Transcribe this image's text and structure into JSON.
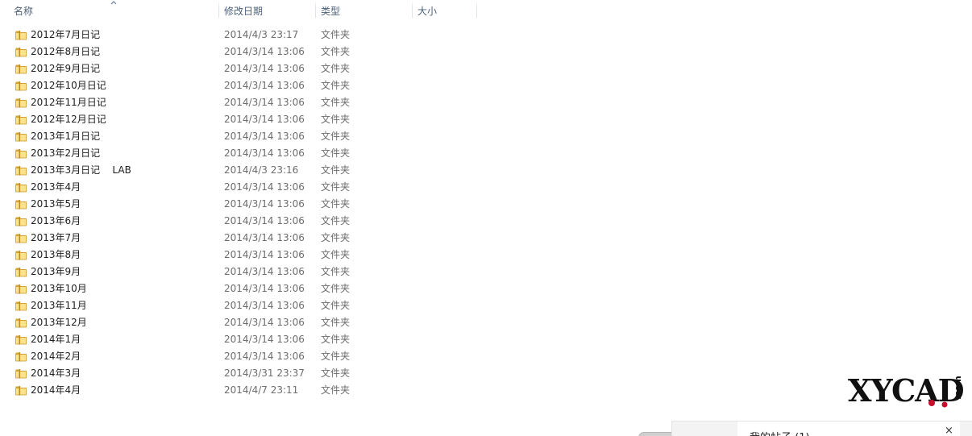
{
  "columns": {
    "name": "名称",
    "date": "修改日期",
    "type": "类型",
    "size": "大小"
  },
  "sort": {
    "column": "name",
    "direction": "ascending",
    "icon": "sort-up-arrow-icon"
  },
  "colors": {
    "header_text": "#4c607a",
    "name_text": "#1e1e1e",
    "detail_text": "#6d6d6d",
    "folder_light": "#fbe28c",
    "folder_dark": "#d9a52c"
  },
  "rows": [
    {
      "name": "2012年7月日记",
      "date": "2014/4/3 23:17",
      "type": "文件夹",
      "size": ""
    },
    {
      "name": "2012年8月日记",
      "date": "2014/3/14 13:06",
      "type": "文件夹",
      "size": ""
    },
    {
      "name": "2012年9月日记",
      "date": "2014/3/14 13:06",
      "type": "文件夹",
      "size": ""
    },
    {
      "name": "2012年10月日记",
      "date": "2014/3/14 13:06",
      "type": "文件夹",
      "size": ""
    },
    {
      "name": "2012年11月日记",
      "date": "2014/3/14 13:06",
      "type": "文件夹",
      "size": ""
    },
    {
      "name": "2012年12月日记",
      "date": "2014/3/14 13:06",
      "type": "文件夹",
      "size": ""
    },
    {
      "name": "2013年1月日记",
      "date": "2014/3/14 13:06",
      "type": "文件夹",
      "size": ""
    },
    {
      "name": "2013年2月日记",
      "date": "2014/3/14 13:06",
      "type": "文件夹",
      "size": ""
    },
    {
      "name": "2013年3月日记    LAB",
      "date": "2014/4/3 23:16",
      "type": "文件夹",
      "size": ""
    },
    {
      "name": "2013年4月",
      "date": "2014/3/14 13:06",
      "type": "文件夹",
      "size": ""
    },
    {
      "name": "2013年5月",
      "date": "2014/3/14 13:06",
      "type": "文件夹",
      "size": ""
    },
    {
      "name": "2013年6月",
      "date": "2014/3/14 13:06",
      "type": "文件夹",
      "size": ""
    },
    {
      "name": "2013年7月",
      "date": "2014/3/14 13:06",
      "type": "文件夹",
      "size": ""
    },
    {
      "name": "2013年8月",
      "date": "2014/3/14 13:06",
      "type": "文件夹",
      "size": ""
    },
    {
      "name": "2013年9月",
      "date": "2014/3/14 13:06",
      "type": "文件夹",
      "size": ""
    },
    {
      "name": "2013年10月",
      "date": "2014/3/14 13:06",
      "type": "文件夹",
      "size": ""
    },
    {
      "name": "2013年11月",
      "date": "2014/3/14 13:06",
      "type": "文件夹",
      "size": ""
    },
    {
      "name": "2013年12月",
      "date": "2014/3/14 13:06",
      "type": "文件夹",
      "size": ""
    },
    {
      "name": "2014年1月",
      "date": "2014/3/14 13:06",
      "type": "文件夹",
      "size": ""
    },
    {
      "name": "2014年2月",
      "date": "2014/3/14 13:06",
      "type": "文件夹",
      "size": ""
    },
    {
      "name": "2014年3月",
      "date": "2014/3/31 23:37",
      "type": "文件夹",
      "size": ""
    },
    {
      "name": "2014年4月",
      "date": "2014/4/7 23:11",
      "type": "文件夹",
      "size": ""
    }
  ],
  "row_icon": "folder-icon",
  "watermark": {
    "text": "XYCAD",
    "suffix": ".com"
  },
  "notification": {
    "title": "我的帖子 (1)",
    "close_label": "×"
  }
}
